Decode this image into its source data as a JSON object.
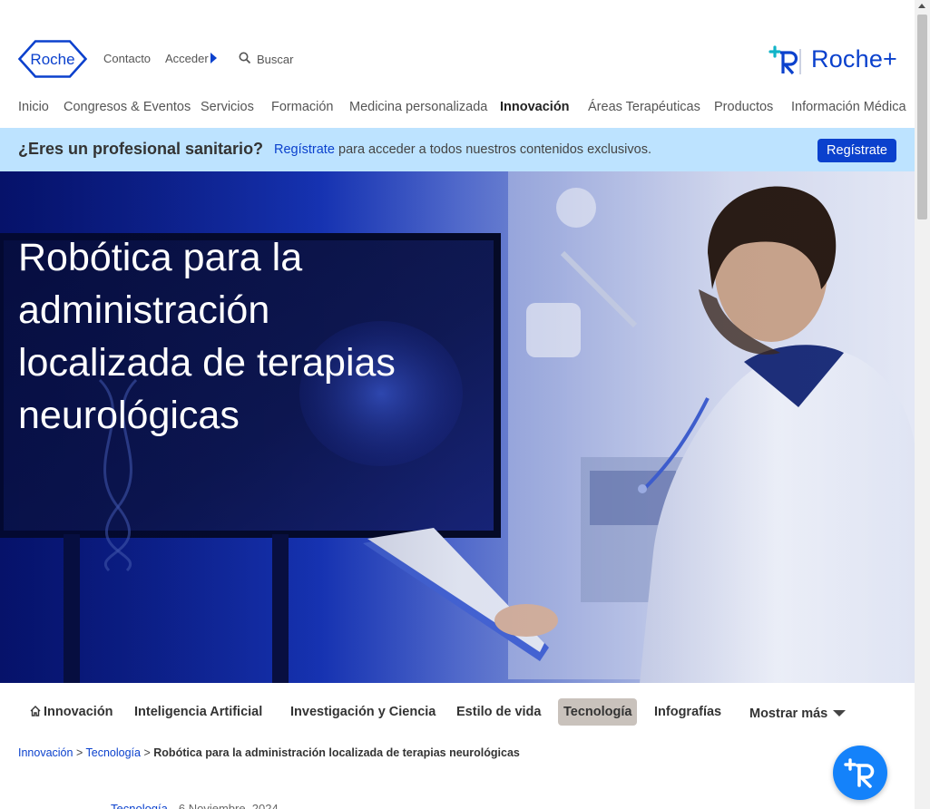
{
  "header": {
    "logo_text": "Roche",
    "contact_label": "Contacto",
    "login_label": "Acceder",
    "search_placeholder": "Buscar",
    "brand_plus": "Roche+"
  },
  "nav": {
    "items": [
      {
        "label": "Inicio",
        "active": false
      },
      {
        "label": "Congresos & Eventos",
        "active": false
      },
      {
        "label": "Servicios",
        "active": false
      },
      {
        "label": "Formación",
        "active": false
      },
      {
        "label": "Medicina personalizada",
        "active": false
      },
      {
        "label": "Innovación",
        "active": true
      },
      {
        "label": "Áreas Terapéuticas",
        "active": false
      },
      {
        "label": "Productos",
        "active": false
      },
      {
        "label": "Información Médica",
        "active": false
      }
    ]
  },
  "banner": {
    "question": "¿Eres un profesional sanitario?",
    "link_label": "Regístrate",
    "rest_text": "para acceder a todos nuestros contenidos exclusivos.",
    "button_label": "Regístrate"
  },
  "hero": {
    "title": "Robótica para la administración localizada de terapias neurológicas"
  },
  "subnav": {
    "tabs": [
      {
        "label": "Innovación",
        "selected": false
      },
      {
        "label": "Inteligencia Artificial",
        "selected": false
      },
      {
        "label": "Investigación y Ciencia",
        "selected": false
      },
      {
        "label": "Estilo de vida",
        "selected": false
      },
      {
        "label": "Tecnología",
        "selected": true
      },
      {
        "label": "Infografías",
        "selected": false
      }
    ],
    "more_label": "Mostrar más"
  },
  "breadcrumb": {
    "items": [
      "Innovación",
      "Tecnología"
    ],
    "separator": ">",
    "current": "Robótica para la administración localizada de terapias neurológicas"
  },
  "article_meta": {
    "category": "Tecnología",
    "date": "6 Noviembre, 2024"
  },
  "colors": {
    "brand_blue": "#0b41cd",
    "banner_bg": "#bde3ff",
    "chat_blue": "#1482fa"
  }
}
